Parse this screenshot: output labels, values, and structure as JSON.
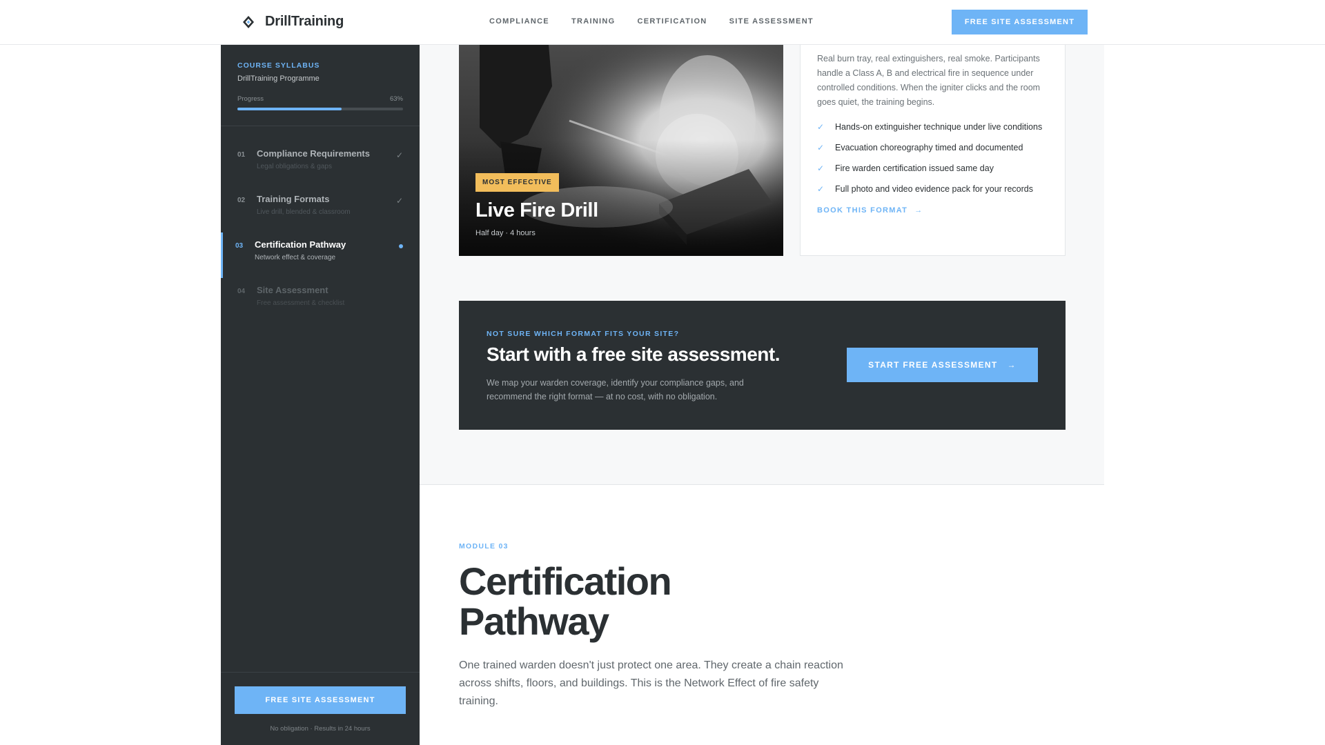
{
  "brand": {
    "name": "DrillTraining",
    "logo_icon": "diamond-logo-icon"
  },
  "nav": {
    "links": [
      "COMPLIANCE",
      "TRAINING",
      "CERTIFICATION",
      "SITE ASSESSMENT"
    ],
    "cta": "FREE SITE ASSESSMENT"
  },
  "sidebar": {
    "kicker": "COURSE SYLLABUS",
    "programme": "DrillTraining Programme",
    "progress_label": "Progress",
    "progress_text": "63%",
    "progress_value": 0.63,
    "items": [
      {
        "num": "01",
        "title": "Compliance Requirements",
        "desc": "Legal obligations & gaps",
        "state": "done"
      },
      {
        "num": "02",
        "title": "Training Formats",
        "desc": "Live drill, blended & classroom",
        "state": "done"
      },
      {
        "num": "03",
        "title": "Certification Pathway",
        "desc": "Network effect & coverage",
        "state": "active"
      },
      {
        "num": "04",
        "title": "Site Assessment",
        "desc": "Free assessment & checklist",
        "state": "locked"
      }
    ],
    "cta": "FREE SITE ASSESSMENT",
    "note": "No obligation · Results in 24 hours"
  },
  "format": {
    "badge": "MOST EFFECTIVE",
    "title": "Live Fire Drill",
    "duration": "Half day · 4 hours",
    "description": "Real burn tray, real extinguishers, real smoke. Participants handle a Class A, B and electrical fire in sequence under controlled conditions. When the igniter clicks and the room goes quiet, the training begins.",
    "features": [
      "Hands-on extinguisher technique under live conditions",
      "Evacuation choreography timed and documented",
      "Fire warden certification issued same day",
      "Full photo and video evidence pack for your records"
    ],
    "link": "BOOK THIS FORMAT"
  },
  "cta_band": {
    "kicker": "NOT SURE WHICH FORMAT FITS YOUR SITE?",
    "title": "Start with a free site assessment.",
    "text": "We map your warden coverage, identify your compliance gaps, and recommend the right format — at no cost, with no obligation.",
    "button": "START FREE ASSESSMENT"
  },
  "module": {
    "kicker": "MODULE 03",
    "title": "Certification Pathway",
    "text": "One trained warden doesn't just protect one area. They create a chain reaction across shifts, floors, and buildings. This is the Network Effect of fire safety training."
  },
  "colors": {
    "accent": "#6eb4f6",
    "dark": "#2b3033",
    "badge": "#f2bd5b"
  }
}
